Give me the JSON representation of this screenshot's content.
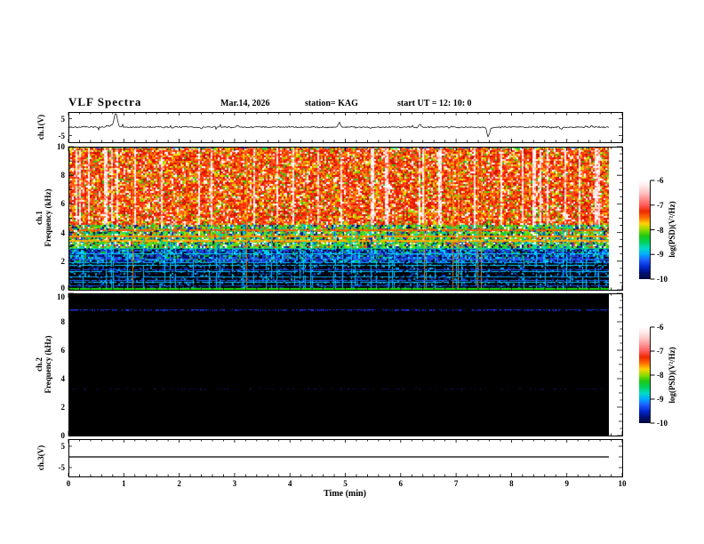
{
  "header": {
    "title": "VLF Spectra",
    "date": "Mar.14, 2026",
    "station": "station= KAG",
    "start_ut": "start UT =  12: 10: 0"
  },
  "axes": {
    "time": {
      "label": "Time (min)",
      "min": 0,
      "max": 10,
      "tick_labels": [
        "0",
        "1",
        "2",
        "3",
        "4",
        "5",
        "6",
        "7",
        "8",
        "9",
        "10"
      ]
    },
    "frequency": {
      "units": "kHz",
      "min": 0,
      "max": 10,
      "tick_labels": [
        "10",
        "8",
        "6",
        "4",
        "2",
        "0"
      ]
    },
    "voltage": {
      "units": "V",
      "tick_labels": [
        "5",
        "-5"
      ]
    }
  },
  "panels": {
    "ch1v": {
      "ylabel": "ch.1(V)"
    },
    "ch1spec": {
      "ylabel_line1": "ch.1",
      "ylabel_line2": "Frequency (kHz)"
    },
    "ch2spec": {
      "ylabel_line1": "ch.2",
      "ylabel_line2": "Frequency (kHz)"
    },
    "ch3v": {
      "ylabel": "ch.3(V)"
    }
  },
  "colorbars": {
    "label": "log(PSD)(V²/Hz)",
    "tick_labels": [
      "-6",
      "-7",
      "-8",
      "-9",
      "-10"
    ],
    "range": [
      -6,
      -10
    ],
    "gradient_top_to_bottom": [
      "#ffffff",
      "#ffe6e6",
      "#ffc2c2",
      "#ff8f8f",
      "#ff5a5a",
      "#f02800",
      "#ff6a00",
      "#ffd200",
      "#8fdc00",
      "#1ec814",
      "#00d25a",
      "#00dcc8",
      "#00aaff",
      "#1e5aff",
      "#0028d2",
      "#001078",
      "#000a3c"
    ]
  },
  "chart_data": [
    {
      "type": "line",
      "panel": "ch.1(V)",
      "xlim": [
        0,
        10
      ],
      "data_end_min": 9.76,
      "ylim": [
        -5,
        5
      ],
      "baseline_v": 0,
      "noise_amplitude_v": 0.45,
      "spikes": [
        {
          "t": 0.7,
          "v": 1.0
        },
        {
          "t": 0.78,
          "v": 1.5
        },
        {
          "t": 0.83,
          "v": 4.5
        },
        {
          "t": 0.86,
          "v": 6.5
        },
        {
          "t": 0.89,
          "v": 2.0
        },
        {
          "t": 2.4,
          "v": -0.9
        },
        {
          "t": 3.05,
          "v": 0.8
        },
        {
          "t": 4.89,
          "v": 3.2
        },
        {
          "t": 5.45,
          "v": -0.9
        },
        {
          "t": 6.35,
          "v": 1.8
        },
        {
          "t": 7.58,
          "v": -6.5
        },
        {
          "t": 7.63,
          "v": -1.2
        },
        {
          "t": 8.9,
          "v": -1.3
        },
        {
          "t": 9.35,
          "v": 0.9
        },
        {
          "t": 9.45,
          "v": 0.7
        }
      ]
    },
    {
      "type": "heatmap",
      "panel": "ch.1 spectrogram",
      "xlim": [
        0,
        10
      ],
      "ylim": [
        0,
        10
      ],
      "data_end_min": 9.76,
      "psd_range_log": [
        -10,
        -6
      ],
      "bands": [
        {
          "f_lo": 4.6,
          "f_hi": 10.0,
          "desc": "intense red/white vertical striations (strong broadband PSD ~ -6.5)"
        },
        {
          "f_lo": 3.0,
          "f_hi": 4.6,
          "desc": "green/yellow mottled band with red streaks (PSD ~ -8)"
        },
        {
          "f_lo": 2.0,
          "f_hi": 3.0,
          "desc": "blue/dark checker with cyan lines (PSD ~ -9)"
        },
        {
          "f_lo": 0.0,
          "f_hi": 2.0,
          "desc": "near-black with cyan horizontal lines (PSD ~ -10)"
        }
      ],
      "horizontal_lines": [
        {
          "f": 4.2,
          "color": "#ff5a00"
        },
        {
          "f": 3.8,
          "color": "#ff8c00"
        },
        {
          "f": 3.5,
          "color": "#ffaa00"
        },
        {
          "f": 2.9,
          "color": "#00e67d"
        },
        {
          "f": 2.55,
          "color": "#00d2ff"
        },
        {
          "f": 2.2,
          "color": "#2864ff"
        },
        {
          "f": 1.95,
          "color": "#00b4ff"
        },
        {
          "f": 1.75,
          "color": "#00d2ff"
        },
        {
          "f": 1.45,
          "color": "#1e50ff"
        },
        {
          "f": 1.3,
          "color": "#00c8ff"
        },
        {
          "f": 0.95,
          "color": "#00a0e6"
        },
        {
          "f": 0.7,
          "color": "#1e64ff"
        },
        {
          "f": 0.55,
          "color": "#00c8ff"
        },
        {
          "f": 0.3,
          "color": "#0a50c8"
        }
      ],
      "bottom_edge_color": "#16d400"
    },
    {
      "type": "heatmap",
      "panel": "ch.2 spectrogram",
      "xlim": [
        0,
        10
      ],
      "ylim": [
        0,
        10
      ],
      "data_end_min": 9.76,
      "psd_range_log": [
        -10,
        -6
      ],
      "background": "#000000",
      "horizontal_lines": [
        {
          "f": 8.85,
          "color": "#2334e0",
          "density": 0.6,
          "desc": "bright intermittent blue line"
        },
        {
          "f": 3.3,
          "color": "#141457",
          "density": 0.22,
          "desc": "very faint blue line"
        }
      ]
    },
    {
      "type": "line",
      "panel": "ch.3(V)",
      "xlim": [
        0,
        10
      ],
      "data_end_min": 9.76,
      "ylim": [
        -5,
        5
      ],
      "flat_value": 0
    }
  ]
}
